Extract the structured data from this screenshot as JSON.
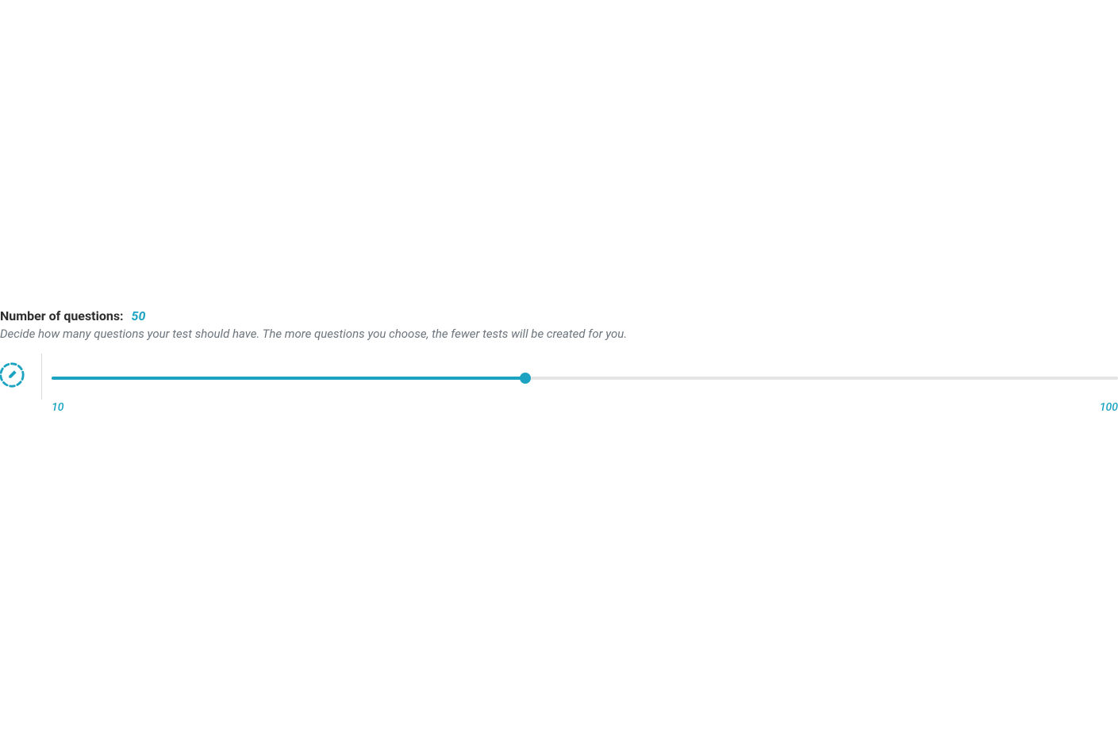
{
  "heading": {
    "label": "Number of questions:",
    "value": "50"
  },
  "description": "Decide how many questions your test should have. The more questions you choose, the fewer tests will be created for you.",
  "slider": {
    "min": 10,
    "max": 100,
    "value": 50,
    "min_label": "10",
    "max_label": "100"
  },
  "colors": {
    "accent": "#1ba3c1",
    "text_muted": "#6c757d",
    "text_dark": "#2d2d2d",
    "track_bg": "#e5e5e5"
  }
}
